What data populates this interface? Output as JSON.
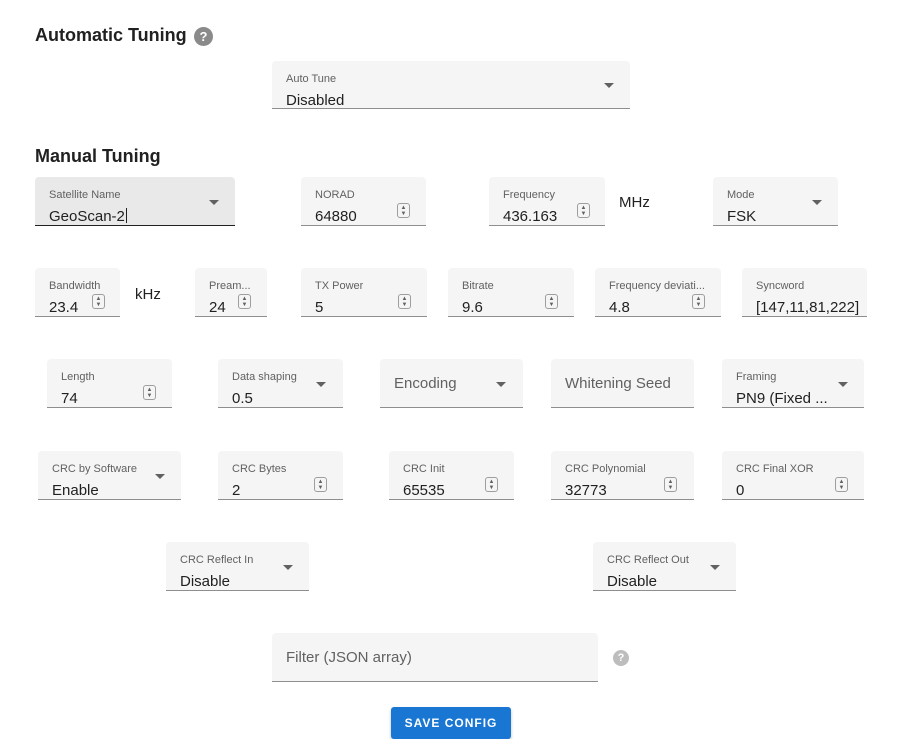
{
  "sections": {
    "automatic_title": "Automatic Tuning",
    "manual_title": "Manual Tuning"
  },
  "help_icon_glyph": "?",
  "colors": {
    "accent": "#1976d2",
    "help_icon_dark": "#8a8a8a",
    "help_icon_light": "#bdbdbd"
  },
  "auto_tune": {
    "label": "Auto Tune",
    "value": "Disabled"
  },
  "satellite_name": {
    "label": "Satellite Name",
    "value": "GeoScan-2"
  },
  "norad": {
    "label": "NORAD",
    "value": "64880"
  },
  "frequency": {
    "label": "Frequency",
    "value": "436.163",
    "unit": "MHz"
  },
  "mode": {
    "label": "Mode",
    "value": "FSK"
  },
  "bandwidth": {
    "label": "Bandwidth",
    "value": "23.4",
    "unit": "kHz"
  },
  "preamble": {
    "label": "Pream...",
    "value": "24"
  },
  "tx_power": {
    "label": "TX Power",
    "value": "5"
  },
  "bitrate": {
    "label": "Bitrate",
    "value": "9.6"
  },
  "frequency_deviation": {
    "label": "Frequency deviati...",
    "value": "4.8"
  },
  "syncword": {
    "label": "Syncword",
    "value": "[147,11,81,222]"
  },
  "length": {
    "label": "Length",
    "value": "74"
  },
  "data_shaping": {
    "label": "Data shaping",
    "value": "0.5"
  },
  "encoding": {
    "placeholder": "Encoding"
  },
  "whitening_seed": {
    "placeholder": "Whitening Seed"
  },
  "framing": {
    "label": "Framing",
    "value": "PN9 (Fixed ..."
  },
  "crc_by_software": {
    "label": "CRC by Software",
    "value": "Enable"
  },
  "crc_bytes": {
    "label": "CRC Bytes",
    "value": "2"
  },
  "crc_init": {
    "label": "CRC Init",
    "value": "65535"
  },
  "crc_polynomial": {
    "label": "CRC Polynomial",
    "value": "32773"
  },
  "crc_final_xor": {
    "label": "CRC Final XOR",
    "value": "0"
  },
  "crc_reflect_in": {
    "label": "CRC Reflect In",
    "value": "Disable"
  },
  "crc_reflect_out": {
    "label": "CRC Reflect Out",
    "value": "Disable"
  },
  "filter": {
    "placeholder": "Filter (JSON array)"
  },
  "save_button": {
    "label": "SAVE CONFIG"
  }
}
